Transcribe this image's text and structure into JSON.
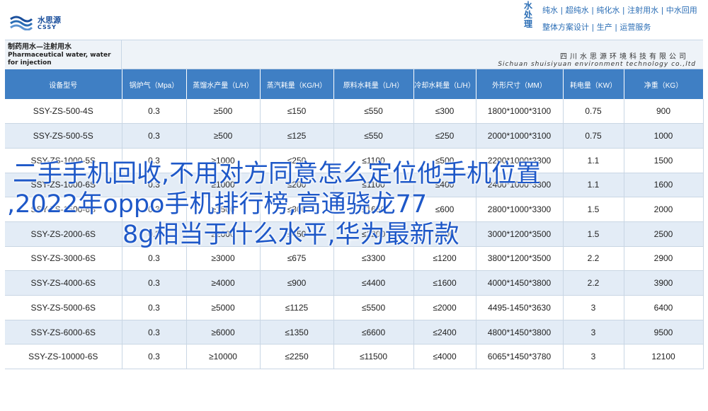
{
  "header": {
    "logo_cn": "水思源",
    "logo_en": "CSSY",
    "water_treatment_label": "水处理",
    "water_products": "纯水 | 超纯水 | 纯化水 | 注射用水 | 中水回用",
    "services": "整体方案设计 | 生产 | 运营服务",
    "icons": {
      "logo": "water-drop-logo-icon"
    },
    "colors": {
      "brand": "#1a4f9c",
      "accent": "#3f7fc4"
    }
  },
  "table": {
    "title_cn": "制药用水—注射用水",
    "title_en": "Pharmaceutical water, water for injection",
    "company_cn": "四川水思源环境科技有限公司",
    "company_en": "Sichuan shuisiyuan environment technology co.,ltd",
    "columns": [
      "设备型号",
      "锅炉气（Mpa）",
      "蒸馏水产量（L/H）",
      "蒸汽耗量（KG/H）",
      "原料水耗量（L/H）",
      "冷却水耗量（L/H）",
      "外形尺寸（MM）",
      "耗电量（KW）",
      "净重（KG）"
    ],
    "rows": [
      [
        "SSY-ZS-500-4S",
        "0.3",
        "≥500",
        "≤150",
        "≤550",
        "≤300",
        "1800*1000*3100",
        "0.75",
        "900"
      ],
      [
        "SSY-ZS-500-5S",
        "0.3",
        "≥500",
        "≤125",
        "≤550",
        "≤250",
        "2000*1000*3100",
        "0.75",
        "1000"
      ],
      [
        "SSY-ZS-1000-5S",
        "0.3",
        "≥1000",
        "≤250",
        "≤1100",
        "≤500",
        "2200*1000*3300",
        "1.1",
        "1500"
      ],
      [
        "SSY-ZS-1000-6S",
        "0.3",
        "≥1000",
        "≤200",
        "≤1100",
        "≤400",
        "2400*1000*3300",
        "1.1",
        "1600"
      ],
      [
        "SSY-ZS-1500-6S",
        "0.3",
        "≥1500",
        "≤300",
        "≤1650",
        "≤600",
        "2800*1000*3300",
        "1.5",
        "2000"
      ],
      [
        "SSY-ZS-2000-6S",
        "0.3",
        "≥2000",
        "≤450",
        "≤2200",
        "≤800",
        "3000*1200*3500",
        "1.5",
        "2500"
      ],
      [
        "SSY-ZS-3000-6S",
        "0.3",
        "≥3000",
        "≤675",
        "≤3300",
        "≤1200",
        "3800*1200*3500",
        "2.2",
        "2900"
      ],
      [
        "SSY-ZS-4000-6S",
        "0.3",
        "≥4000",
        "≤900",
        "≤4400",
        "≤1600",
        "4000*1450*3800",
        "2.2",
        "3900"
      ],
      [
        "SSY-ZS-5000-6S",
        "0.3",
        "≥5000",
        "≤1125",
        "≤5500",
        "≤2000",
        "4495-1450*3630",
        "3",
        "6400"
      ],
      [
        "SSY-ZS-6000-6S",
        "0.3",
        "≥6000",
        "≤1350",
        "≤6600",
        "≤2400",
        "4800*1450*3800",
        "3",
        "9500"
      ],
      [
        "SSY-ZS-10000-6S",
        "0.3",
        "≥10000",
        "≤2250",
        "≤11500",
        "≤4000",
        "6065*1450*3780",
        "3",
        "12100"
      ]
    ]
  },
  "headline": {
    "line1": "二手手机回收,不用对方同意怎么定位他手机位置",
    "line2": ",2022年oppo手机排行榜,高通骁龙77",
    "line3": "8g相当于什么水平,华为最新款"
  }
}
